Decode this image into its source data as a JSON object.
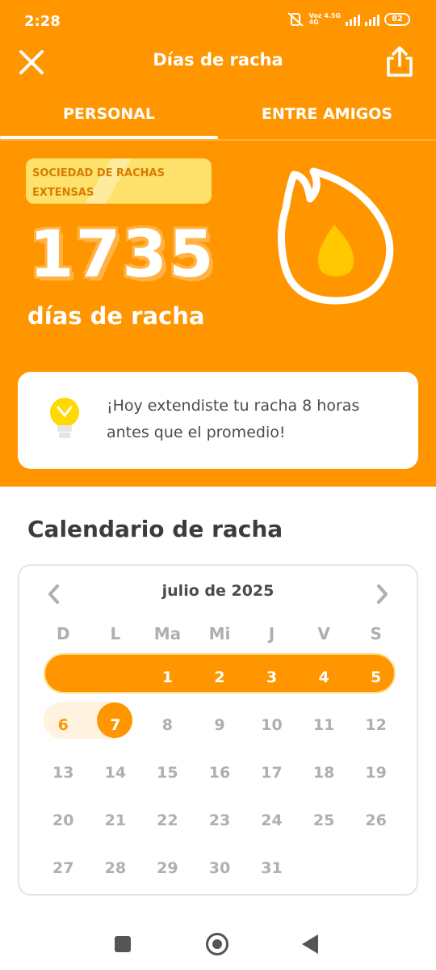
{
  "status_bar": {
    "time": "2:28",
    "network_top": "Voz 4.5G",
    "network_bottom": "4G",
    "battery": "82"
  },
  "header": {
    "title": "Días de racha",
    "close_icon": "close-icon",
    "share_icon": "share-icon"
  },
  "tabs": [
    {
      "label": "PERSONAL",
      "active": true
    },
    {
      "label": "ENTRE AMIGOS",
      "active": false
    }
  ],
  "streak": {
    "badge": "SOCIEDAD DE RACHAS EXTENSAS",
    "count": "1735",
    "label": "días de racha"
  },
  "tip": {
    "text": "¡Hoy extendiste tu racha 8 horas antes que el promedio!",
    "icon": "lightbulb-icon"
  },
  "calendar": {
    "title": "Calendario de racha",
    "month": "julio de 2025",
    "weekdays": [
      "D",
      "L",
      "Ma",
      "Mi",
      "J",
      "V",
      "S"
    ],
    "weeks": [
      [
        "",
        "",
        "1",
        "2",
        "3",
        "4",
        "5"
      ],
      [
        "6",
        "7",
        "8",
        "9",
        "10",
        "11",
        "12"
      ],
      [
        "13",
        "14",
        "15",
        "16",
        "17",
        "18",
        "19"
      ],
      [
        "20",
        "21",
        "22",
        "23",
        "24",
        "25",
        "26"
      ],
      [
        "27",
        "28",
        "29",
        "30",
        "31",
        "",
        ""
      ]
    ],
    "streak_days": [
      "1",
      "2",
      "3",
      "4",
      "5",
      "7"
    ],
    "faded_days": [
      "6"
    ],
    "today": "7"
  },
  "colors": {
    "primary_orange": "#FF9600",
    "badge_yellow": "#FDE16A",
    "badge_text": "#D97B00"
  }
}
